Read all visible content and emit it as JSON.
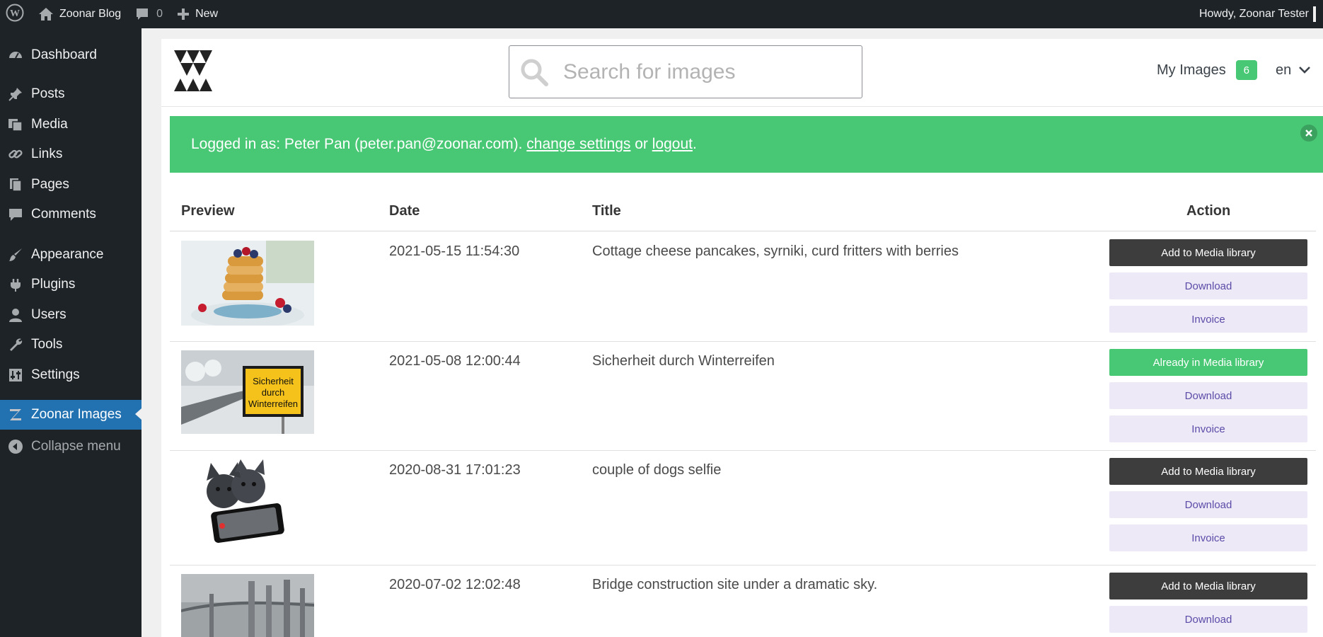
{
  "adminbar": {
    "site_name": "Zoonar Blog",
    "comments_count": "0",
    "new_label": "New",
    "howdy": "Howdy, Zoonar Tester"
  },
  "sidebar": {
    "items": [
      {
        "label": "Dashboard",
        "icon": "dashboard-icon"
      },
      {
        "label": "Posts",
        "icon": "pin-icon"
      },
      {
        "label": "Media",
        "icon": "media-icon"
      },
      {
        "label": "Links",
        "icon": "link-icon"
      },
      {
        "label": "Pages",
        "icon": "pages-icon"
      },
      {
        "label": "Comments",
        "icon": "comment-icon"
      },
      {
        "label": "Appearance",
        "icon": "brush-icon"
      },
      {
        "label": "Plugins",
        "icon": "plugin-icon"
      },
      {
        "label": "Users",
        "icon": "user-icon"
      },
      {
        "label": "Tools",
        "icon": "wrench-icon"
      },
      {
        "label": "Settings",
        "icon": "settings-icon"
      },
      {
        "label": "Zoonar Images",
        "icon": "zoonar-icon",
        "active": true
      },
      {
        "label": "Collapse menu",
        "icon": "collapse-icon"
      }
    ]
  },
  "header": {
    "search_placeholder": "Search for images",
    "my_images_label": "My Images",
    "my_images_count": "6",
    "language": "en"
  },
  "notice": {
    "prefix": "Logged in as: Peter Pan (peter.pan@zoonar.com). ",
    "change_settings": "change settings",
    "or": " or ",
    "logout": "logout",
    "suffix": "."
  },
  "table": {
    "headers": {
      "preview": "Preview",
      "date": "Date",
      "title": "Title",
      "action": "Action"
    },
    "rows": [
      {
        "date": "2021-05-15 11:54:30",
        "title": "Cottage cheese pancakes, syrniki, curd fritters with berries",
        "primary_action": "Add to Media library",
        "in_library": false,
        "download": "Download",
        "invoice": "Invoice"
      },
      {
        "date": "2021-05-08 12:00:44",
        "title": "Sicherheit durch Winterreifen",
        "primary_action": "Already in Media library",
        "in_library": true,
        "download": "Download",
        "invoice": "Invoice",
        "sign_text": [
          "Sicherheit",
          "durch",
          "Winterreifen"
        ]
      },
      {
        "date": "2020-08-31 17:01:23",
        "title": "couple of dogs selfie",
        "primary_action": "Add to Media library",
        "in_library": false,
        "download": "Download",
        "invoice": "Invoice"
      },
      {
        "date": "2020-07-02 12:02:48",
        "title": "Bridge construction site under a dramatic sky.",
        "primary_action": "Add to Media library",
        "in_library": false,
        "download": "Download"
      }
    ]
  },
  "colors": {
    "admin_dark": "#1d2327",
    "accent_blue": "#2271b1",
    "success_green": "#48c774",
    "button_dark": "#3d3d3d",
    "button_light": "#ede9f7",
    "button_light_text": "#5c4ca8"
  }
}
